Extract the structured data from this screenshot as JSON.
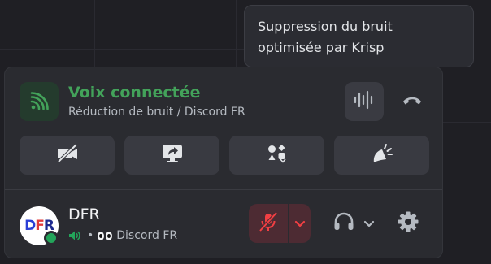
{
  "tooltip": {
    "line1": "Suppression du bruit",
    "line2": "optimisée par Krisp"
  },
  "voice": {
    "title": "Voix connectée",
    "subtitle": "Réduction de bruit / Discord FR",
    "icon": "signal-icon",
    "status_color": "#43a25a"
  },
  "controls": {
    "noise_suppression_icon": "noise-suppression-icon",
    "disconnect_icon": "phone-hangup-icon"
  },
  "actions": [
    {
      "icon": "camera-off-icon"
    },
    {
      "icon": "screen-share-icon"
    },
    {
      "icon": "activities-icon"
    },
    {
      "icon": "soundboard-icon"
    }
  ],
  "user": {
    "avatar_text": {
      "d": "D",
      "f": "F",
      "r": "R"
    },
    "name": "DFR",
    "status_bullet": "•",
    "status_text": "Discord FR",
    "status_dot_color": "#23a55a",
    "mute_color": "#f23f43"
  }
}
